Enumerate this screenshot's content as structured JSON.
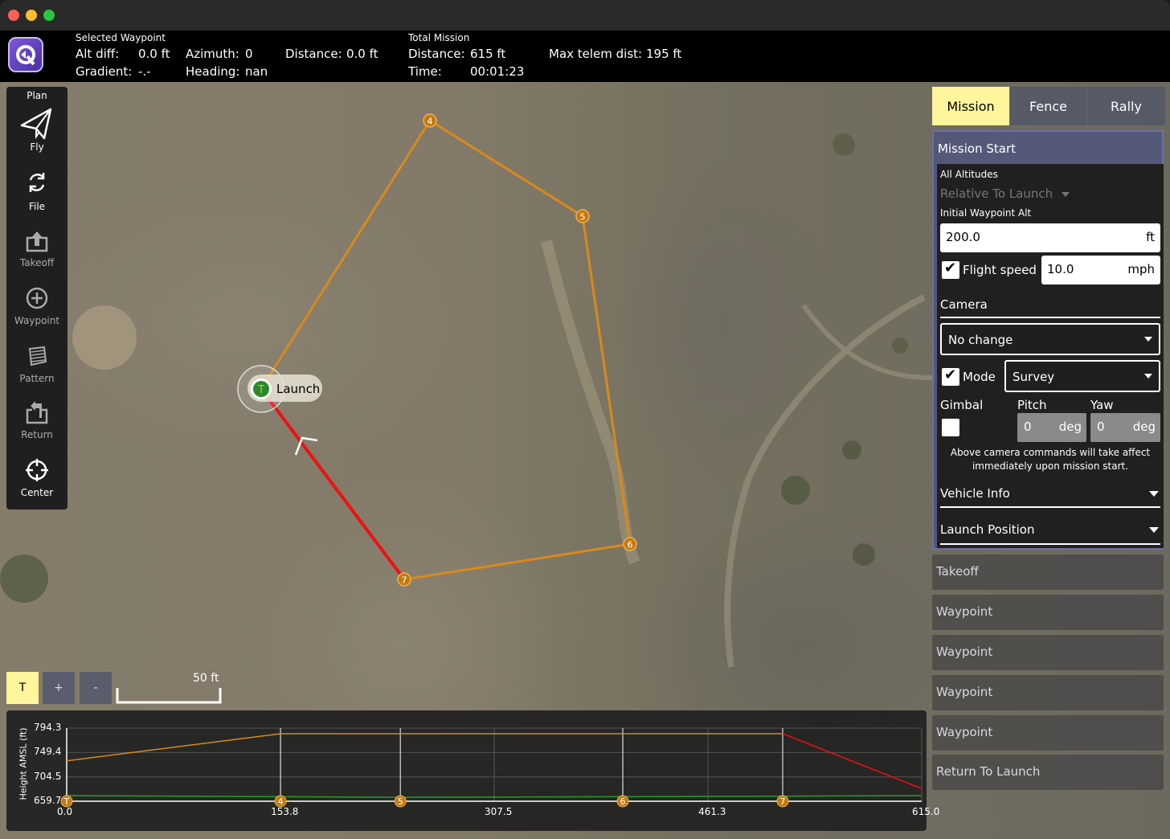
{
  "window": {
    "close_color": "#ff5f57",
    "min_color": "#febc2e",
    "max_color": "#28c840"
  },
  "toolbar": {
    "selected_waypoint_title": "Selected Waypoint",
    "alt_diff_label": "Alt diff:",
    "alt_diff_value": "0.0 ft",
    "gradient_label": "Gradient:",
    "gradient_value": "-.-",
    "azimuth_label": "Azimuth:",
    "azimuth_value": "0",
    "heading_label": "Heading:",
    "heading_value": "nan",
    "distance_label": "Distance:",
    "distance_value": "0.0 ft",
    "total_mission_title": "Total Mission",
    "total_distance_label": "Distance:",
    "total_distance_value": "615 ft",
    "time_label": "Time:",
    "time_value": "00:01:23",
    "max_telem_label": "Max telem dist:",
    "max_telem_value": "195 ft"
  },
  "plan_tools": {
    "title": "Plan",
    "items": [
      {
        "label": "Fly",
        "icon": "paper-plane-icon"
      },
      {
        "label": "File",
        "icon": "sync-icon"
      },
      {
        "label": "Takeoff",
        "icon": "takeoff-icon"
      },
      {
        "label": "Waypoint",
        "icon": "plus-circle-icon"
      },
      {
        "label": "Pattern",
        "icon": "pattern-icon"
      },
      {
        "label": "Return",
        "icon": "return-icon"
      },
      {
        "label": "Center",
        "icon": "crosshair-icon"
      }
    ]
  },
  "map": {
    "launch_label": "Launch",
    "launch_marker": "T",
    "waypoints": [
      "4",
      "5",
      "6",
      "7"
    ],
    "path_color": "#d88a1a",
    "return_color": "#ee1111",
    "launch_color": "#2a8a2a"
  },
  "zoom": {
    "takeoff_label": "T",
    "zoom_in": "+",
    "zoom_out": "-",
    "scale": "50 ft"
  },
  "right_panel": {
    "tabs": [
      "Mission",
      "Fence",
      "Rally"
    ],
    "active_tab": "Mission",
    "mission_start": {
      "header": "Mission Start",
      "all_altitudes": "All Altitudes",
      "altitude_mode": "Relative To Launch",
      "initial_wp_alt_label": "Initial Waypoint Alt",
      "initial_wp_alt_value": "200.0",
      "initial_wp_alt_unit": "ft",
      "flight_speed_label": "Flight speed",
      "flight_speed_checked": true,
      "flight_speed_value": "10.0",
      "flight_speed_unit": "mph",
      "camera_label": "Camera",
      "camera_value": "No change",
      "mode_label": "Mode",
      "mode_checked": true,
      "mode_value": "Survey",
      "gimbal_label": "Gimbal",
      "pitch_label": "Pitch",
      "yaw_label": "Yaw",
      "pitch_value": "0",
      "yaw_value": "0",
      "deg_unit": "deg",
      "note": "Above camera commands will take affect immediately upon mission start.",
      "vehicle_info": "Vehicle Info",
      "launch_position": "Launch Position"
    },
    "items": [
      "Takeoff",
      "Waypoint",
      "Waypoint",
      "Waypoint",
      "Waypoint",
      "Return To Launch"
    ]
  },
  "chart_data": {
    "type": "line",
    "title": "",
    "xlabel": "",
    "ylabel": "Height AMSL (ft)",
    "xlim": [
      0.0,
      615.0
    ],
    "ylim": [
      659.7,
      794.3
    ],
    "x_ticks": [
      "0.0",
      "153.8",
      "307.5",
      "461.3",
      "615.0"
    ],
    "y_ticks": [
      "794.3",
      "749.4",
      "704.5",
      "659.7"
    ],
    "series": [
      {
        "color": "#d88a1a",
        "x": [
          0,
          153.8,
          240,
          400,
          515
        ],
        "y": [
          734,
          784,
          784,
          784,
          784
        ]
      },
      {
        "color": "#ee1111",
        "x": [
          515,
          615
        ],
        "y": [
          784,
          683
        ]
      },
      {
        "color": "#2a9a2a",
        "x": [
          0,
          153.8,
          240,
          400,
          515,
          615
        ],
        "y": [
          670,
          668,
          667,
          668,
          669,
          670
        ]
      }
    ],
    "markers": [
      {
        "label": "T",
        "x": 0
      },
      {
        "label": "4",
        "x": 153.8
      },
      {
        "label": "5",
        "x": 240
      },
      {
        "label": "6",
        "x": 400
      },
      {
        "label": "7",
        "x": 515
      }
    ]
  }
}
